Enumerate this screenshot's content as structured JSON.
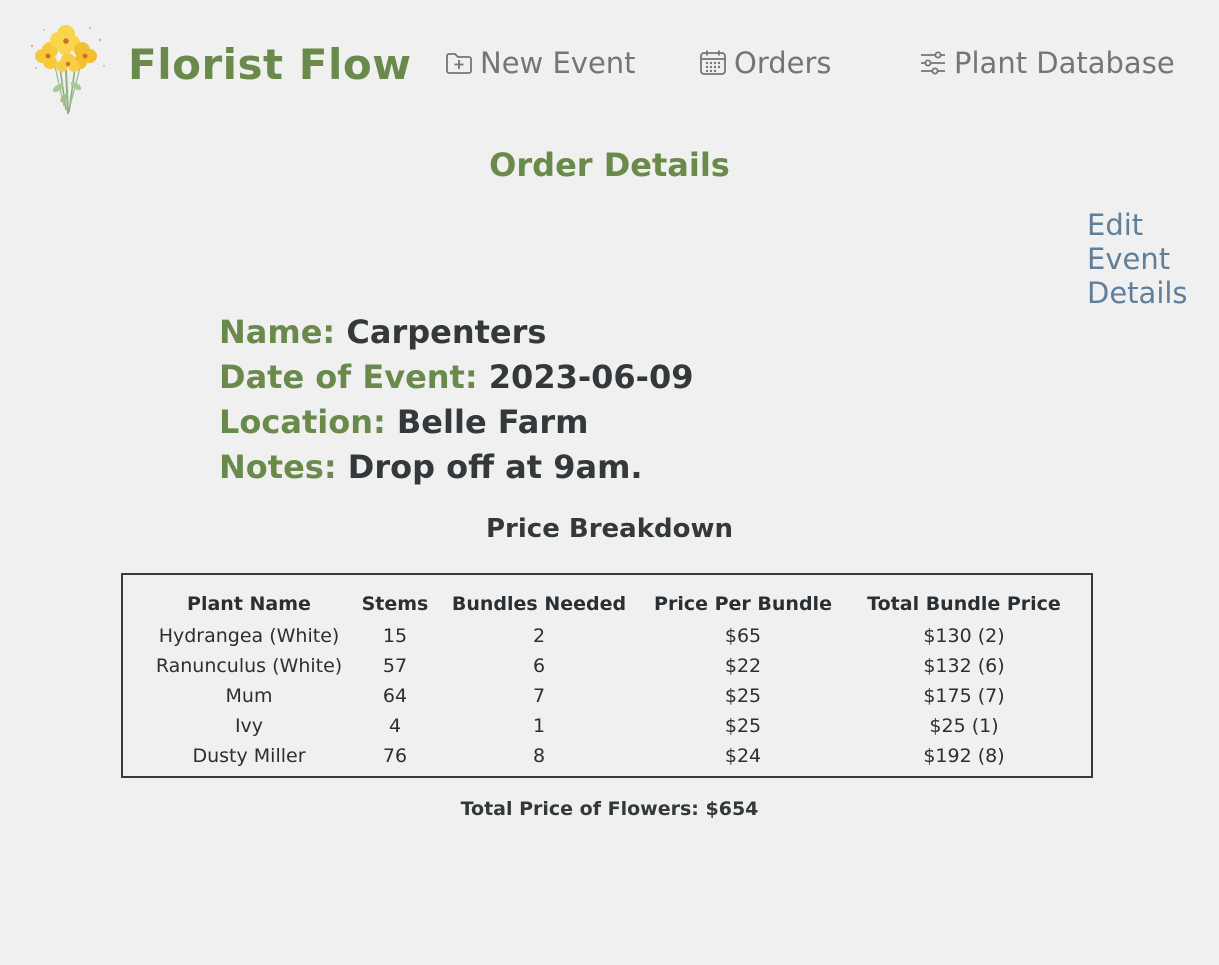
{
  "header": {
    "brand": "Florist Flow",
    "nav": {
      "new_event": "New Event",
      "orders": "Orders",
      "plant_database": "Plant Database"
    }
  },
  "page_title": "Order Details",
  "edit_link": {
    "line1": "Edit",
    "line2": "Event",
    "line3": "Details"
  },
  "event": {
    "name_label": "Name:",
    "name_value": "Carpenters",
    "date_label": "Date of Event:",
    "date_value": "2023-06-09",
    "location_label": "Location:",
    "location_value": "Belle Farm",
    "notes_label": "Notes:",
    "notes_value": "Drop off at 9am."
  },
  "breakdown": {
    "title": "Price Breakdown",
    "columns": [
      "Plant Name",
      "Stems",
      "Bundles Needed",
      "Price Per Bundle",
      "Total Bundle Price"
    ],
    "rows": [
      [
        "Hydrangea (White)",
        "15",
        "2",
        "$65",
        "$130 (2)"
      ],
      [
        "Ranunculus (White)",
        "57",
        "6",
        "$22",
        "$132 (6)"
      ],
      [
        "Mum",
        "64",
        "7",
        "$25",
        "$175 (7)"
      ],
      [
        "Ivy",
        "4",
        "1",
        "$25",
        "$25 (1)"
      ],
      [
        "Dusty Miller",
        "76",
        "8",
        "$24",
        "$192 (8)"
      ]
    ],
    "total": "Total Price of Flowers: $654"
  },
  "colors": {
    "brand_green": "#6a8a4c",
    "link_blue": "#5f7f9a",
    "nav_gray": "#757575",
    "text_dark": "#33383b"
  }
}
